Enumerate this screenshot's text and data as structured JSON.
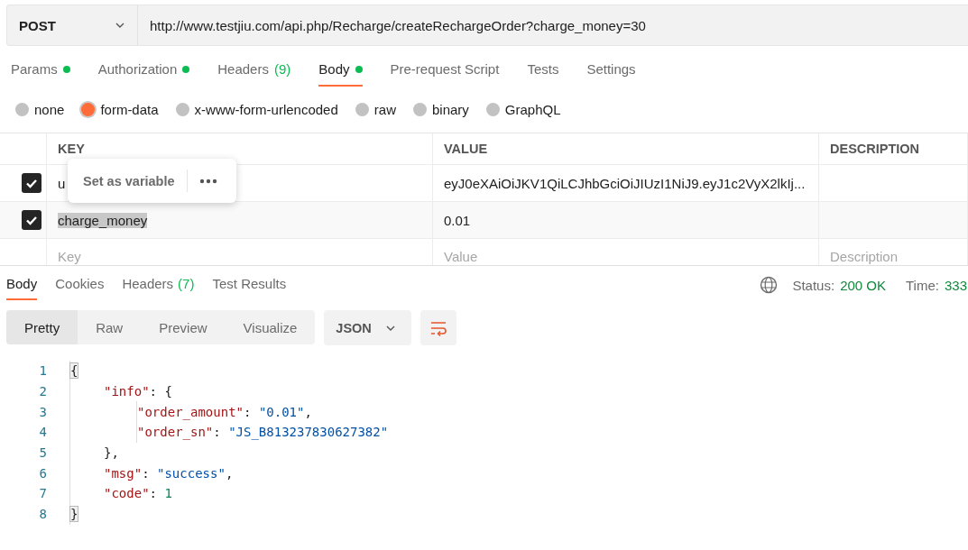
{
  "request": {
    "method": "POST",
    "url": "http://www.testjiu.com/api.php/Recharge/createRechargeOrder?charge_money=30"
  },
  "request_tabs": [
    {
      "label": "Params",
      "dot": true,
      "selected": false
    },
    {
      "label": "Authorization",
      "dot": true,
      "selected": false
    },
    {
      "label": "Headers",
      "count": "(9)",
      "dot": false,
      "selected": false
    },
    {
      "label": "Body",
      "dot": true,
      "selected": true
    },
    {
      "label": "Pre-request Script",
      "dot": false,
      "selected": false
    },
    {
      "label": "Tests",
      "dot": false,
      "selected": false
    },
    {
      "label": "Settings",
      "dot": false,
      "selected": false
    }
  ],
  "body_types": [
    {
      "label": "none",
      "selected": false
    },
    {
      "label": "form-data",
      "selected": true
    },
    {
      "label": "x-www-form-urlencoded",
      "selected": false
    },
    {
      "label": "raw",
      "selected": false
    },
    {
      "label": "binary",
      "selected": false
    },
    {
      "label": "GraphQL",
      "selected": false
    }
  ],
  "params_table": {
    "columns": [
      "KEY",
      "VALUE",
      "DESCRIPTION"
    ],
    "rows": [
      {
        "checked": true,
        "key": "u",
        "value": "eyJ0eXAiOiJKV1QiLCJhbGciOiJIUzI1NiJ9.eyJ1c2VyX2lkIj...",
        "key_selected": false
      },
      {
        "checked": true,
        "key": "charge_money",
        "value": "0.01",
        "key_selected": true
      }
    ],
    "new_row": {
      "key": {
        "placeholder": "Key"
      },
      "value": {
        "placeholder": "Value"
      },
      "description": {
        "placeholder": "Description"
      }
    },
    "popup": {
      "action": "Set as variable"
    }
  },
  "response_tabs": [
    {
      "label": "Body",
      "selected": true
    },
    {
      "label": "Cookies",
      "selected": false
    },
    {
      "label": "Headers",
      "count": "(7)",
      "selected": false
    },
    {
      "label": "Test Results",
      "selected": false
    }
  ],
  "response_status": {
    "status_label": "Status:",
    "status": "200 OK",
    "time_label": "Time:",
    "time": "333"
  },
  "view_modes": [
    {
      "label": "Pretty",
      "selected": true
    },
    {
      "label": "Raw",
      "selected": false
    },
    {
      "label": "Preview",
      "selected": false
    },
    {
      "label": "Visualize",
      "selected": false
    }
  ],
  "format": "JSON",
  "code_lines": [
    {
      "number": "1",
      "tokens": [
        {
          "kind": "bracket",
          "text": "{"
        }
      ]
    },
    {
      "number": "2",
      "tokens": [
        {
          "kind": "key",
          "text": "\"info\""
        },
        {
          "kind": "punct",
          "text": ": {"
        }
      ]
    },
    {
      "number": "3",
      "tokens": [
        {
          "kind": "key",
          "text": "\"order_amount\""
        },
        {
          "kind": "punct",
          "text": ": "
        },
        {
          "kind": "string",
          "text": "\"0.01\""
        },
        {
          "kind": "punct",
          "text": ","
        }
      ]
    },
    {
      "number": "4",
      "tokens": [
        {
          "kind": "key",
          "text": "\"order_sn\""
        },
        {
          "kind": "punct",
          "text": ": "
        },
        {
          "kind": "string",
          "text": "\"JS_B813237830627382\""
        }
      ]
    },
    {
      "number": "5",
      "tokens": [
        {
          "kind": "punct",
          "text": "},"
        }
      ]
    },
    {
      "number": "6",
      "tokens": [
        {
          "kind": "key",
          "text": "\"msg\""
        },
        {
          "kind": "punct",
          "text": ": "
        },
        {
          "kind": "string",
          "text": "\"success\""
        },
        {
          "kind": "punct",
          "text": ","
        }
      ]
    },
    {
      "number": "7",
      "tokens": [
        {
          "kind": "key",
          "text": "\"code\""
        },
        {
          "kind": "punct",
          "text": ": "
        },
        {
          "kind": "number",
          "text": "1"
        }
      ]
    },
    {
      "number": "8",
      "tokens": [
        {
          "kind": "bracket",
          "text": "}"
        }
      ]
    }
  ]
}
